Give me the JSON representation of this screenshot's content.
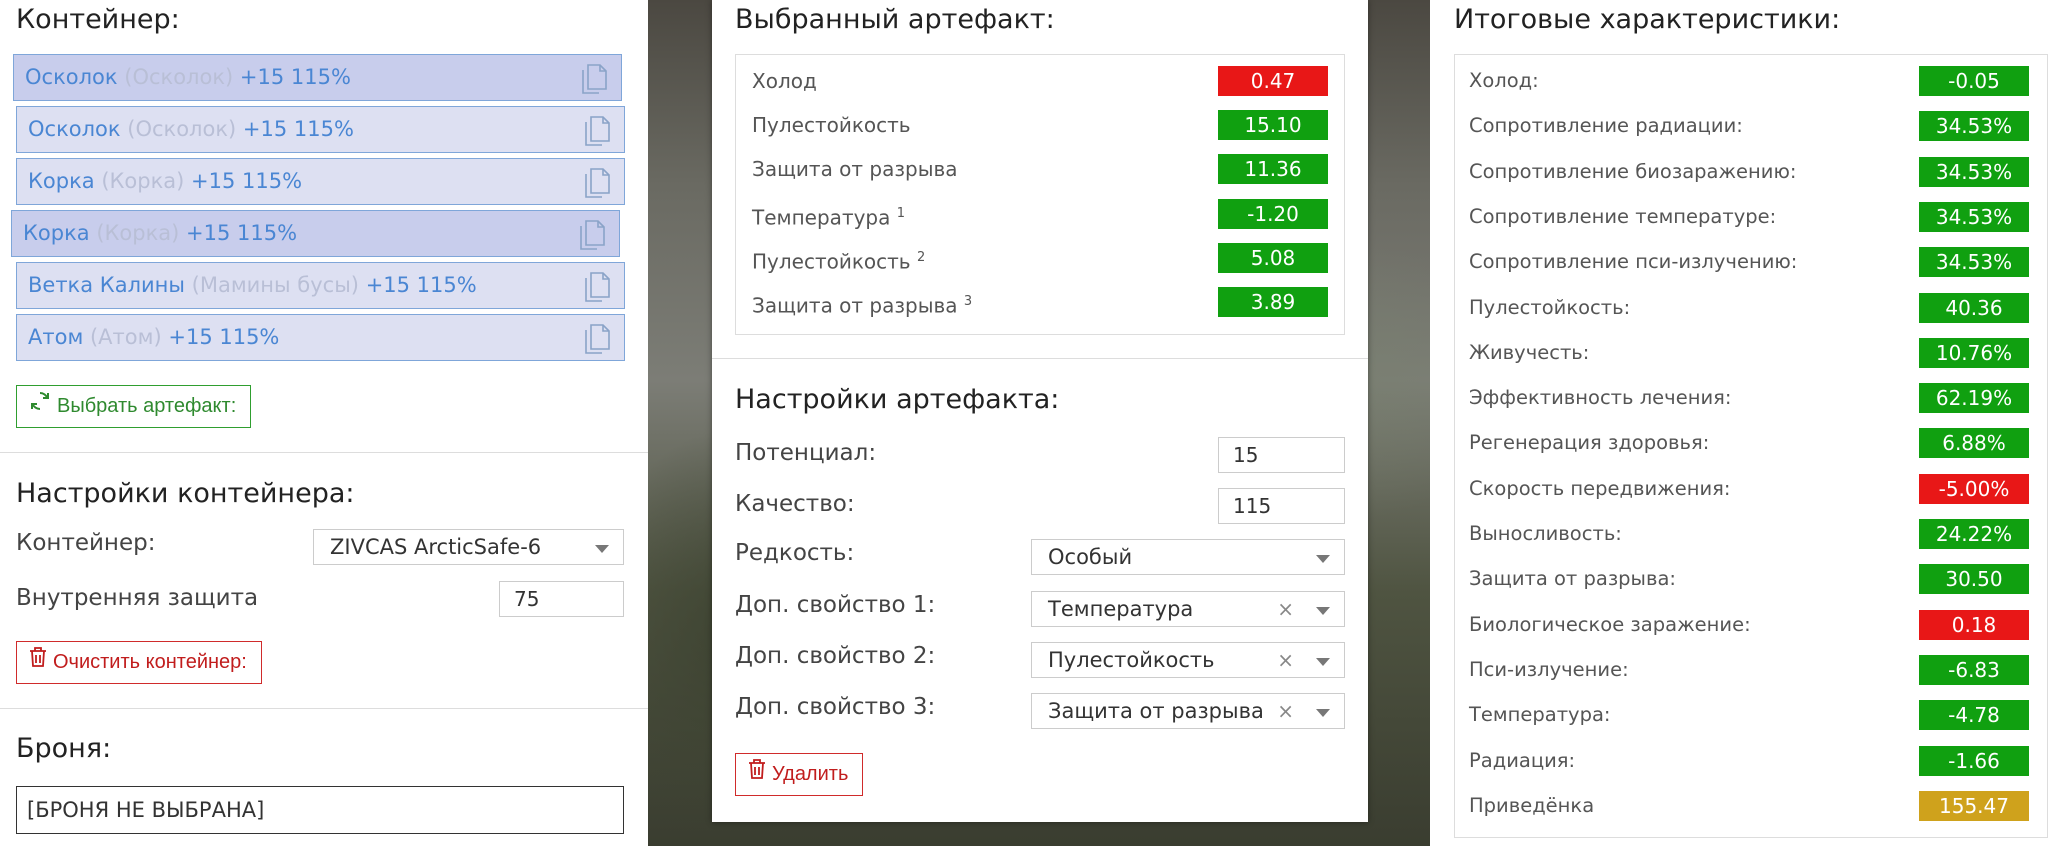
{
  "colors": {
    "positive": "#10a010",
    "negative": "#e81717",
    "neutral": "#cfa21c",
    "accent": "#4a86d3"
  },
  "container_panel": {
    "title": "Контейнер:",
    "slots": [
      {
        "name": "Осколок",
        "sub": "(Осколок)",
        "bonus": "+15 115%",
        "selected": true
      },
      {
        "name": "Осколок",
        "sub": "(Осколок)",
        "bonus": "+15 115%",
        "selected": false
      },
      {
        "name": "Корка",
        "sub": "(Корка)",
        "bonus": "+15 115%",
        "selected": false
      },
      {
        "name": "Корка",
        "sub": "(Корка)",
        "bonus": "+15 115%",
        "selected": true
      },
      {
        "name": "Ветка Калины",
        "sub": "(Мамины бусы)",
        "bonus": "+15 115%",
        "selected": false
      },
      {
        "name": "Атом",
        "sub": "(Атом)",
        "bonus": "+15 115%",
        "selected": false
      }
    ],
    "choose_button": "Выбрать артефакт:",
    "settings_title": "Настройки контейнера:",
    "container_label": "Контейнер:",
    "container_value": "ZIVCAS ArcticSafe-6",
    "inner_protection_label": "Внутренняя защита",
    "inner_protection_value": "75",
    "clear_button": "Очистить контейнер:",
    "armor_title": "Броня:",
    "armor_value": "[БРОНЯ НЕ ВЫБРАНА]"
  },
  "artifact_panel": {
    "title": "Выбранный артефакт:",
    "stats": [
      {
        "name": "Холод",
        "sup": "",
        "value": "0.47",
        "kind": "neg"
      },
      {
        "name": "Пулестойкость",
        "sup": "",
        "value": "15.10",
        "kind": "pos"
      },
      {
        "name": "Защита от разрыва",
        "sup": "",
        "value": "11.36",
        "kind": "pos"
      },
      {
        "name": "Температура",
        "sup": "1",
        "value": "-1.20",
        "kind": "pos"
      },
      {
        "name": "Пулестойкость",
        "sup": "2",
        "value": "5.08",
        "kind": "pos"
      },
      {
        "name": "Защита от разрыва",
        "sup": "3",
        "value": "3.89",
        "kind": "pos"
      }
    ],
    "settings_title": "Настройки артефакта:",
    "potential_label": "Потенциал:",
    "potential_value": "15",
    "quality_label": "Качество:",
    "quality_value": "115",
    "rarity_label": "Редкость:",
    "rarity_value": "Особый",
    "extra1_label": "Доп. свойство 1:",
    "extra1_value": "Температура",
    "extra2_label": "Доп. свойство 2:",
    "extra2_value": "Пулестойкость",
    "extra3_label": "Доп. свойство 3:",
    "extra3_value": "Защита от разрыва",
    "clear_symbol": "×",
    "delete_button": "Удалить"
  },
  "totals_panel": {
    "title": "Итоговые характеристики:",
    "stats": [
      {
        "name": "Холод:",
        "value": "-0.05",
        "kind": "pos"
      },
      {
        "name": "Сопротивление радиации:",
        "value": "34.53%",
        "kind": "pos"
      },
      {
        "name": "Сопротивление биозаражению:",
        "value": "34.53%",
        "kind": "pos"
      },
      {
        "name": "Сопротивление температуре:",
        "value": "34.53%",
        "kind": "pos"
      },
      {
        "name": "Сопротивление пси-излучению:",
        "value": "34.53%",
        "kind": "pos"
      },
      {
        "name": "Пулестойкость:",
        "value": "40.36",
        "kind": "pos"
      },
      {
        "name": "Живучесть:",
        "value": "10.76%",
        "kind": "pos"
      },
      {
        "name": "Эффективность лечения:",
        "value": "62.19%",
        "kind": "pos"
      },
      {
        "name": "Регенерация здоровья:",
        "value": "6.88%",
        "kind": "pos"
      },
      {
        "name": "Скорость передвижения:",
        "value": "-5.00%",
        "kind": "neg"
      },
      {
        "name": "Выносливость:",
        "value": "24.22%",
        "kind": "pos"
      },
      {
        "name": "Защита от разрыва:",
        "value": "30.50",
        "kind": "pos"
      },
      {
        "name": "Биологическое заражение:",
        "value": "0.18",
        "kind": "neg"
      },
      {
        "name": "Пси-излучение:",
        "value": "-6.83",
        "kind": "pos"
      },
      {
        "name": "Температура:",
        "value": "-4.78",
        "kind": "pos"
      },
      {
        "name": "Радиация:",
        "value": "-1.66",
        "kind": "pos"
      },
      {
        "name": "Приведёнка",
        "value": "155.47",
        "kind": "neu"
      }
    ]
  }
}
